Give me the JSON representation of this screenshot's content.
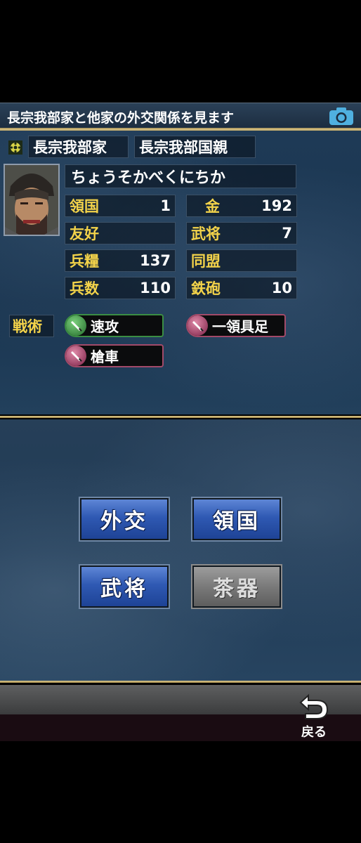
{
  "header": {
    "title": "長宗我部家と他家の外交関係を見ます",
    "camera_icon": "camera-icon"
  },
  "clan": {
    "name": "長宗我部家",
    "leader": "長宗我部国親",
    "leader_reading": "ちょうそかべくにちか"
  },
  "stats": {
    "territories_label": "領国",
    "territories_value": "1",
    "gold_label": "金",
    "gold_value": "192",
    "friendship_label": "友好",
    "friendship_value": "",
    "generals_label": "武将",
    "generals_value": "7",
    "provisions_label": "兵糧",
    "provisions_value": "137",
    "alliance_label": "同盟",
    "alliance_value": "",
    "soldiers_label": "兵数",
    "soldiers_value": "110",
    "guns_label": "鉄砲",
    "guns_value": "10"
  },
  "tactics": {
    "label": "戦術",
    "items": [
      {
        "name": "速攻",
        "color": "green"
      },
      {
        "name": "一領具足",
        "color": "red"
      },
      {
        "name": "槍車",
        "color": "red"
      }
    ]
  },
  "menu": {
    "diplomacy": "外交",
    "territory": "領国",
    "generals": "武将",
    "tea_utensils": "茶器"
  },
  "footer": {
    "back_label": "戻る",
    "back_icon": "return-arrow-icon"
  },
  "colors": {
    "label_yellow": "#f3d34a",
    "button_blue": "#2f59b3",
    "gold_line": "#c9b57a"
  }
}
